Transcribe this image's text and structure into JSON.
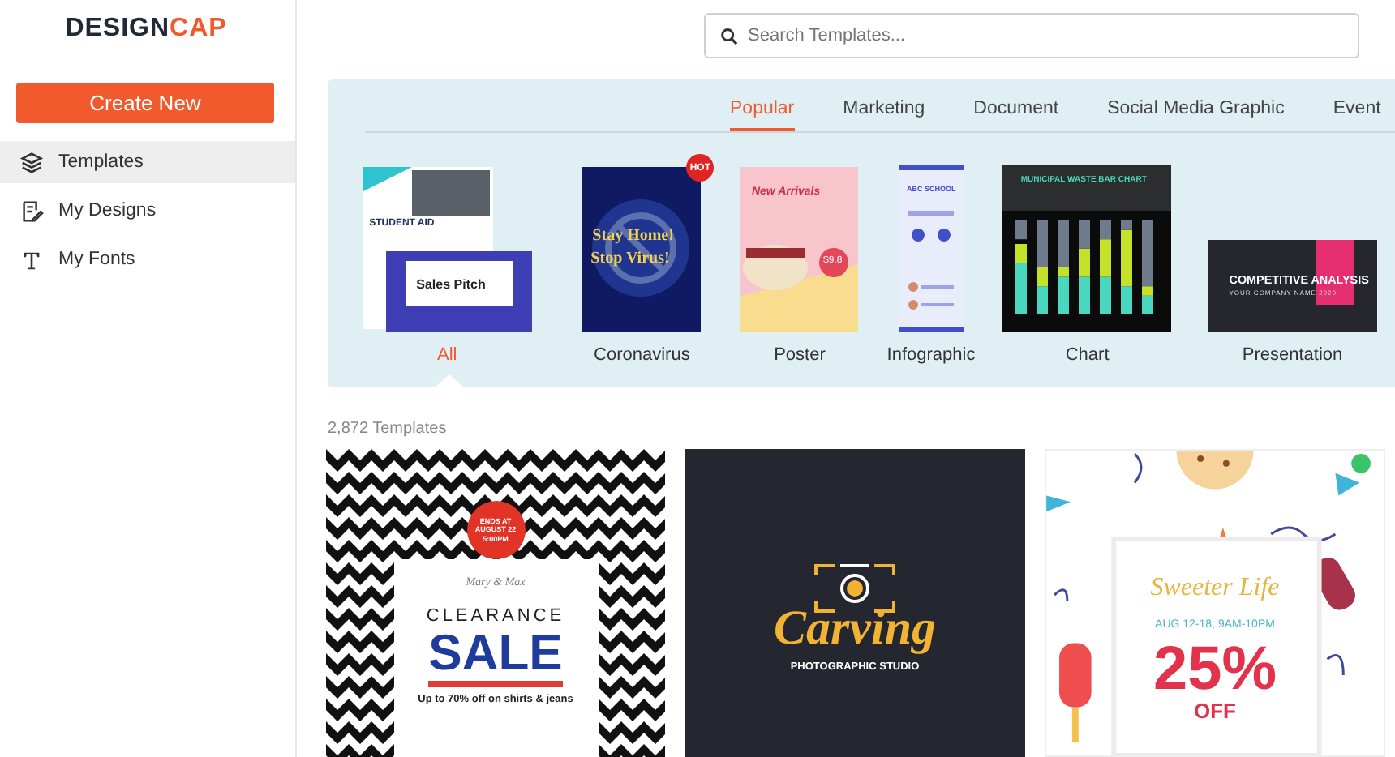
{
  "logo": {
    "parts": [
      {
        "text": "DESIGN",
        "accent": false
      },
      {
        "text": "CAP",
        "accent": true
      }
    ]
  },
  "sidebar": {
    "create_button": "Create New",
    "items": [
      {
        "label": "Templates",
        "kind": "layers",
        "selected": true
      },
      {
        "label": "My Designs",
        "kind": "edit",
        "selected": false
      },
      {
        "label": "My Fonts",
        "kind": "text",
        "selected": false
      }
    ]
  },
  "search": {
    "placeholder": "Search Templates..."
  },
  "category_tabs": [
    {
      "label": "Popular",
      "selected": true
    },
    {
      "label": "Marketing",
      "selected": false
    },
    {
      "label": "Document",
      "selected": false
    },
    {
      "label": "Social Media Graphic",
      "selected": false
    },
    {
      "label": "Event",
      "selected": false
    }
  ],
  "categories": [
    {
      "label": "All",
      "kind": "collage",
      "selected": true,
      "texts": [
        "STUDENT AID",
        "Sales Pitch"
      ]
    },
    {
      "label": "Coronavirus",
      "kind": "virus",
      "selected": false,
      "badge": "HOT",
      "texts": [
        "Stay Home!",
        "Stop Virus!"
      ]
    },
    {
      "label": "Poster",
      "kind": "poster",
      "selected": false,
      "texts": [
        "New Arrivals",
        "$9.8"
      ]
    },
    {
      "label": "Infographic",
      "kind": "infographic",
      "selected": false,
      "texts": [
        "ABC SCHOOL"
      ]
    },
    {
      "label": "Chart",
      "kind": "chart",
      "selected": false,
      "texts": [
        "MUNICIPAL WASTE BAR CHART"
      ]
    },
    {
      "label": "Presentation",
      "kind": "presentation",
      "selected": false,
      "texts": [
        "COMPETITIVE ANALYSIS",
        "YOUR COMPANY NAME 2020"
      ]
    }
  ],
  "template_count": "2,872 Templates",
  "templates": [
    {
      "kind": "clearance",
      "badge_lines": [
        "ENDS AT",
        "AUGUST 22",
        "5:00PM"
      ],
      "subtitle": "Mary & Max",
      "title": "CLEARANCE",
      "headline": "SALE",
      "note": "Up to 70% off on shirts & jeans"
    },
    {
      "kind": "logo",
      "title": "Carving",
      "subtitle": "PHOTOGRAPHIC STUDIO"
    },
    {
      "kind": "confetti",
      "title": "Sweeter Life",
      "subtitle": "AUG 12-18, 9AM-10PM",
      "headline": "25%",
      "note": "OFF"
    }
  ]
}
